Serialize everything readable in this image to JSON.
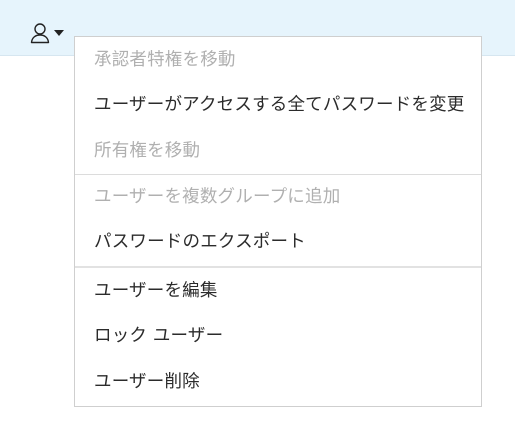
{
  "header": {
    "user_menu_icon": "user-icon",
    "dropdown_caret_icon": "caret-down-icon"
  },
  "menu": {
    "items": [
      {
        "label": "承認者特権を移動",
        "enabled": false
      },
      {
        "label": "ユーザーがアクセスする全てパスワードを変更",
        "enabled": true
      },
      {
        "label": "所有権を移動",
        "enabled": false
      },
      {
        "label": "ユーザーを複数グループに追加",
        "enabled": false
      },
      {
        "label": "パスワードのエクスポート",
        "enabled": true
      },
      {
        "label": "ユーザーを編集",
        "enabled": true
      },
      {
        "label": "ロック ユーザー",
        "enabled": true
      },
      {
        "label": "ユーザー削除",
        "enabled": true
      }
    ]
  },
  "colors": {
    "header_background": "#e6f4fc",
    "text_enabled": "#2b2b2b",
    "text_disabled": "#b0b0b0"
  }
}
